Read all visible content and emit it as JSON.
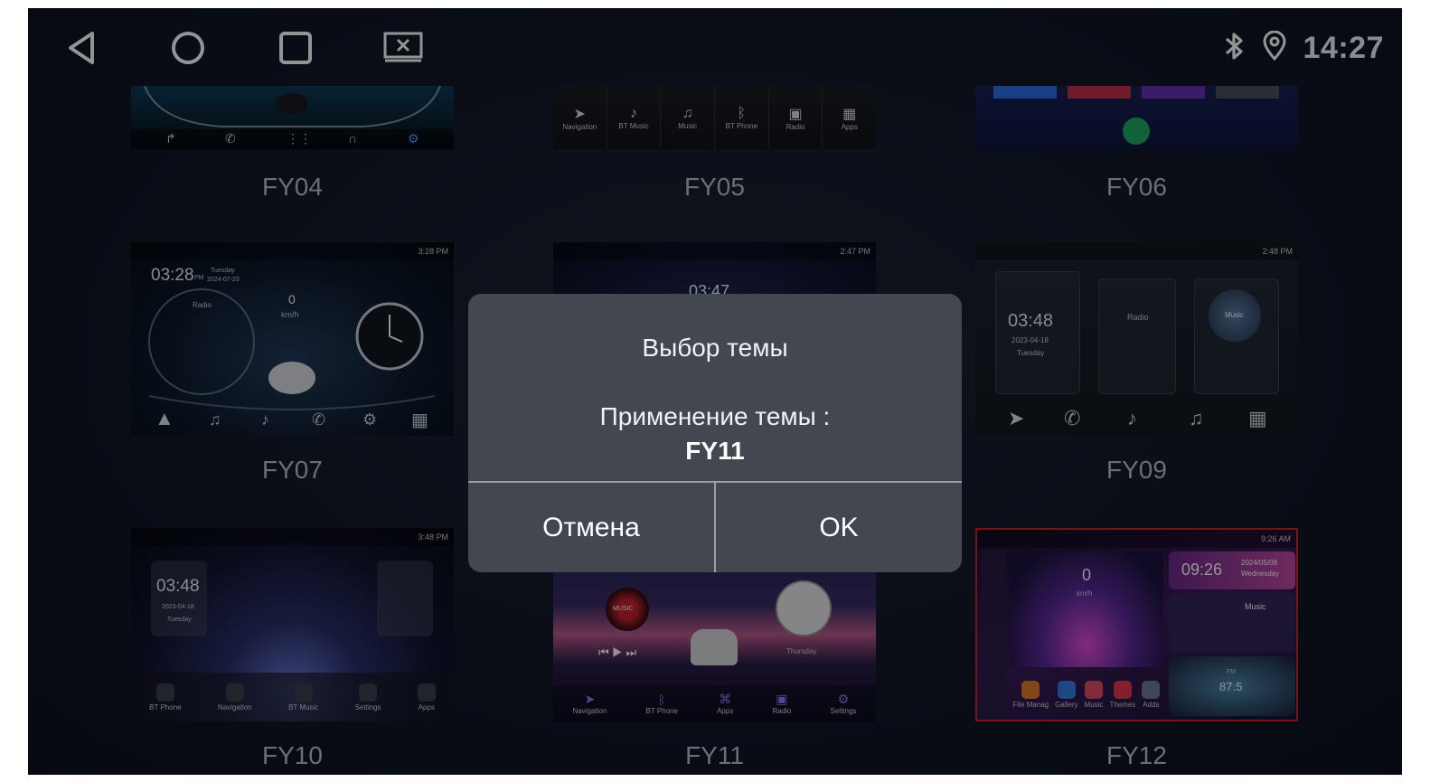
{
  "status_bar": {
    "time": "14:27",
    "icons": [
      "bluetooth-icon",
      "location-pin-icon"
    ],
    "nav": [
      "back-icon",
      "home-icon",
      "recents-icon",
      "screen-off-icon"
    ]
  },
  "themes": [
    {
      "id": "FY04",
      "label": "FY04"
    },
    {
      "id": "FY05",
      "label": "FY05",
      "dock": [
        "Navigation",
        "BT Music",
        "Music",
        "BT Phone",
        "Radio",
        "Apps"
      ]
    },
    {
      "id": "FY06",
      "label": "FY06"
    },
    {
      "id": "FY07",
      "label": "FY07",
      "clock": "03:28",
      "clock_suffix": "PM",
      "day": "Tuesday",
      "date": "2024-07-23",
      "radio": "Radio",
      "speed": "0",
      "speed_unit": "km/h",
      "status_time": "3:28 PM"
    },
    {
      "id": "FY08",
      "label": "",
      "clock": "03:47",
      "status_time": "2:47 PM"
    },
    {
      "id": "FY09",
      "label": "FY09",
      "clock": "03:48",
      "date": "2023-04-18",
      "day": "Tuesday",
      "radio": "Radio",
      "music": "Music",
      "status_time": "2:48 PM"
    },
    {
      "id": "FY10",
      "label": "FY10",
      "clock": "03:48",
      "date": "2023-04-18",
      "day": "Tuesday",
      "status_time": "3:48 PM",
      "dock": [
        "BT Phone",
        "Navigation",
        "BT Music",
        "Settings",
        "Apps"
      ]
    },
    {
      "id": "FY11",
      "label": "FY11",
      "music_badge": "MUSIC",
      "day": "Thursday",
      "dock": [
        "Navigation",
        "BT Phone",
        "Apps",
        "Radio",
        "Settings"
      ]
    },
    {
      "id": "FY12",
      "label": "FY12",
      "clock": "09:26",
      "date": "2024/05/08",
      "day": "Wednesday",
      "speed": "0",
      "speed_unit": "km/h",
      "music": "Music",
      "fm": "FM",
      "freq": "87.5",
      "status_time": "9:26 AM",
      "dock": [
        "File Manag",
        "Gallery",
        "Music",
        "Themes",
        "Adds"
      ]
    }
  ],
  "dialog": {
    "title": "Выбор темы",
    "message": "Применение темы :",
    "theme_name": "FY11",
    "cancel_label": "Отмена",
    "ok_label": "OK"
  },
  "colors": {
    "background": "#121827",
    "dialog_bg": "#424750",
    "selected_border": "#d2202c"
  }
}
